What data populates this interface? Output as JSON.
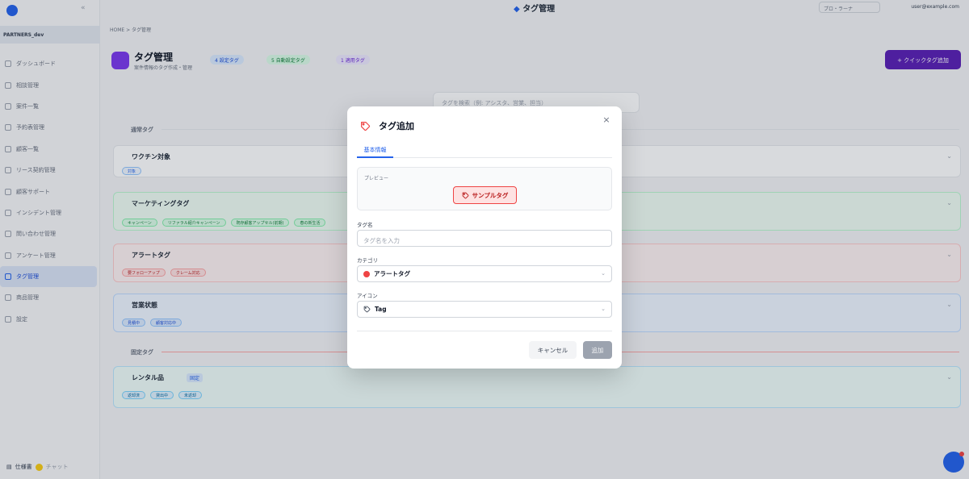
{
  "app": {
    "page_title": "タグ管理",
    "topbar_plan": "プロ・ラーナ ",
    "topbar_user": "user@example.com",
    "org_name": "PARTNERS_dev",
    "breadcrumb": "HOME  >  タグ管理",
    "sidebar": [
      {
        "label": "ダッシュボード",
        "icon": "dashboard-icon"
      },
      {
        "label": "相談管理",
        "icon": "phone-icon"
      },
      {
        "label": "案件一覧",
        "icon": "list-icon"
      },
      {
        "label": "予約表管理",
        "icon": "calendar-icon"
      },
      {
        "label": "顧客一覧",
        "icon": "users-icon"
      },
      {
        "label": "リース契約管理",
        "icon": "contract-icon"
      },
      {
        "label": "顧客サポート",
        "icon": "support-icon"
      },
      {
        "label": "インシデント管理",
        "icon": "incident-icon"
      },
      {
        "label": "問い合わせ管理",
        "icon": "chat-icon"
      },
      {
        "label": "アンケート管理",
        "icon": "survey-icon"
      },
      {
        "label": "タグ管理",
        "icon": "tag-icon",
        "active": true
      },
      {
        "label": "商品管理",
        "icon": "product-icon"
      },
      {
        "label": "設定",
        "icon": "gear-icon"
      }
    ],
    "sidebar_bottom": {
      "doc": "仕様書",
      "chat": "チャット"
    },
    "header": {
      "title": "タグ管理",
      "subtitle": "案件情報のタグ作成・管理",
      "stats": [
        "4 設定タグ",
        "5 自動設定タグ",
        "1 適用タグ"
      ],
      "cta": "+ クイックタグ追加"
    },
    "search_placeholder": "タグを検索（例: アシスタ、営業、担当）",
    "sections": [
      {
        "label": "通常タグ"
      },
      {
        "label": "固定タグ"
      }
    ],
    "cards": [
      {
        "title": "ワクチン対象",
        "chips": [
          "対象"
        ]
      },
      {
        "title": "マーケティングタグ",
        "chips": [
          "キャンペーン",
          "リファラル紹介キャンペーン",
          "既存顧客アップセル(前期)",
          "春の新生活"
        ]
      },
      {
        "title": "アラートタグ",
        "chips": [
          "要フォローアップ",
          "クレーム対応"
        ]
      },
      {
        "title": "営業状態",
        "chips": [
          "見積中",
          "顧客対応中"
        ]
      },
      {
        "title": "レンタル品",
        "badge": "固定",
        "chips": [
          "返却済",
          "貸出中",
          "未返却"
        ]
      }
    ]
  },
  "modal": {
    "title": "タグ追加",
    "close_label": "×",
    "tab_label": "基本情報",
    "preview_label": "プレビュー",
    "preview_tag_text": "サンプルタグ",
    "name_label": "タグ名",
    "name_placeholder": "タグ名を入力",
    "name_value": "",
    "category_label": "カテゴリ",
    "category_value": "アラートタグ",
    "category_color": "#ef4444",
    "icon_label": "アイコン",
    "icon_value": "Tag",
    "cancel_label": "キャンセル",
    "add_label": "追加"
  },
  "colors": {
    "primary": "#2563eb",
    "alert": "#ef4444",
    "alert_bg": "#fee2e2",
    "disabled_button": "#9ca3af"
  }
}
